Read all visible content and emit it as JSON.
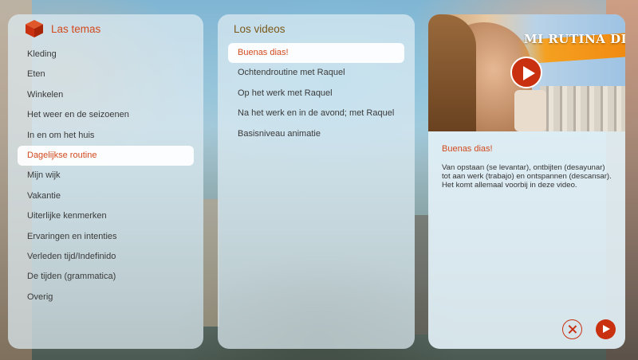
{
  "themes": {
    "title": "Las temas",
    "icon": "cube-icon",
    "items": [
      {
        "label": "Kleding"
      },
      {
        "label": "Eten"
      },
      {
        "label": "Winkelen"
      },
      {
        "label": "Het weer en de seizoenen"
      },
      {
        "label": "In en om het huis"
      },
      {
        "label": "Dagelijkse routine",
        "active": true
      },
      {
        "label": "Mijn wijk"
      },
      {
        "label": "Vakantie"
      },
      {
        "label": "Uiterlijke kenmerken"
      },
      {
        "label": "Ervaringen en intenties"
      },
      {
        "label": "Verleden tijd/Indefinido"
      },
      {
        "label": "De tijden (grammatica)"
      },
      {
        "label": "Overig"
      }
    ]
  },
  "videos": {
    "title": "Los videos",
    "items": [
      {
        "label": "Buenas dias!",
        "active": true
      },
      {
        "label": "Ochtendroutine met Raquel"
      },
      {
        "label": "Op het werk met Raquel"
      },
      {
        "label": "Na het werk en in de avond; met Raquel"
      },
      {
        "label": "Basisniveau animatie"
      }
    ]
  },
  "detail": {
    "thumbnail_title": "MI RUTINA DIARIA",
    "title": "Buenas dias!",
    "description": "Van opstaan (se levantar), ontbijten (desayunar) tot aan werk (trabajo) en ontspannen (descansar). Het komt allemaal voorbij in deze video."
  },
  "colors": {
    "accent": "#d24a1e",
    "play": "#c8300f"
  }
}
